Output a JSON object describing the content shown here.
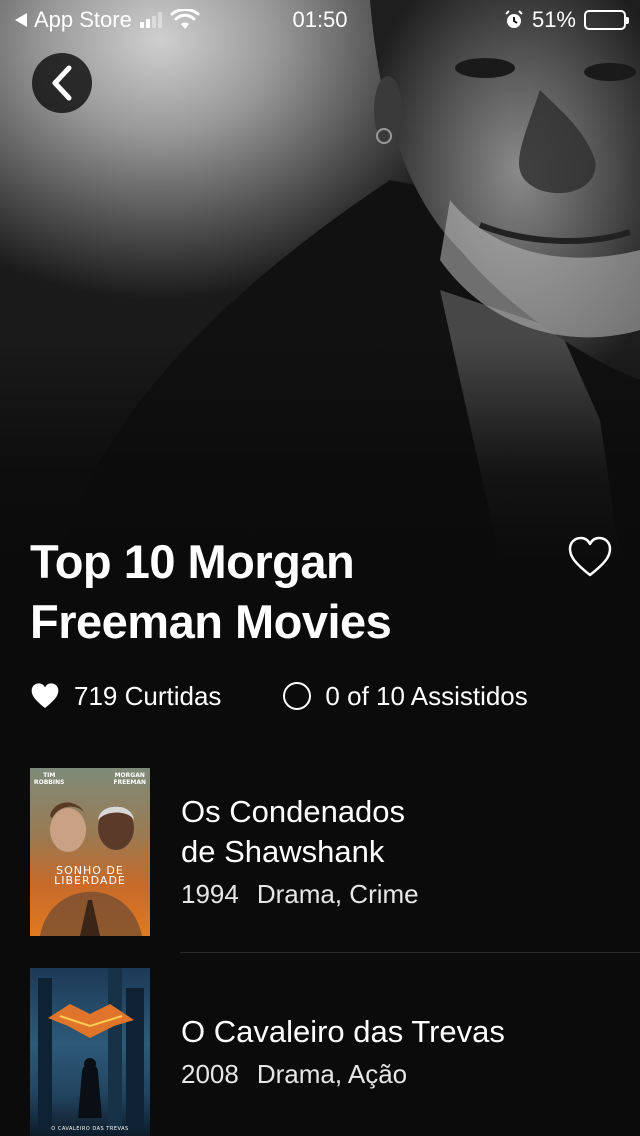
{
  "status_bar": {
    "back_app": "App Store",
    "time": "01:50",
    "battery": "51%",
    "battery_level": 0.51
  },
  "list": {
    "title_line1": "Top 10 Morgan",
    "title_line2": "Freeman Movies",
    "likes": "719 Curtidas",
    "watched": "0 of 10 Assistidos"
  },
  "movies": [
    {
      "title_line1": "Os Condenados",
      "title_line2": "de Shawshank",
      "year": "1994",
      "genres": "Drama, Crime",
      "poster_top_left": "TIM\nROBBINS",
      "poster_top_right": "MORGAN\nFREEMAN",
      "poster_title": "SONHO DE\nLIBERDADE"
    },
    {
      "title": "O Cavaleiro das Trevas",
      "year": "2008",
      "genres": "Drama, Ação",
      "poster_bottom": "O CAVALEIRO DAS TREVAS"
    }
  ],
  "icons": {
    "back": "chevron-left-icon",
    "favorite": "heart-outline-icon",
    "likes": "heart-filled-icon",
    "watched": "circle-outline-icon",
    "wifi": "wifi-icon",
    "alarm": "alarm-icon"
  }
}
